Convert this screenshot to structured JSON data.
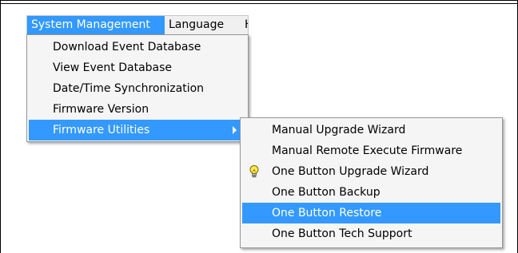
{
  "menubar": {
    "items": [
      {
        "label": "System Management",
        "active": true
      },
      {
        "label": "Language",
        "active": false
      },
      {
        "label": "H",
        "active": false
      }
    ]
  },
  "system_menu": {
    "items": [
      {
        "label": "Download Event Database"
      },
      {
        "label": "View Event Database"
      },
      {
        "label": "Date/Time Synchronization"
      },
      {
        "label": "Firmware Version"
      },
      {
        "label": "Firmware Utilities",
        "highlighted": true,
        "has_submenu": true
      }
    ]
  },
  "firmware_submenu": {
    "items": [
      {
        "label": "Manual Upgrade Wizard"
      },
      {
        "label": "Manual Remote Execute Firmware"
      },
      {
        "label": "One Button Upgrade Wizard",
        "icon": "lightbulb-icon"
      },
      {
        "label": "One Button Backup"
      },
      {
        "label": "One Button Restore",
        "highlighted": true
      },
      {
        "label": "One Button Tech Support"
      }
    ]
  },
  "colors": {
    "highlight": "#3399ff",
    "menu_bg": "#f5f5f5",
    "menubar_bg": "#f0f0f0",
    "bulb_fill": "#ffe84d"
  }
}
